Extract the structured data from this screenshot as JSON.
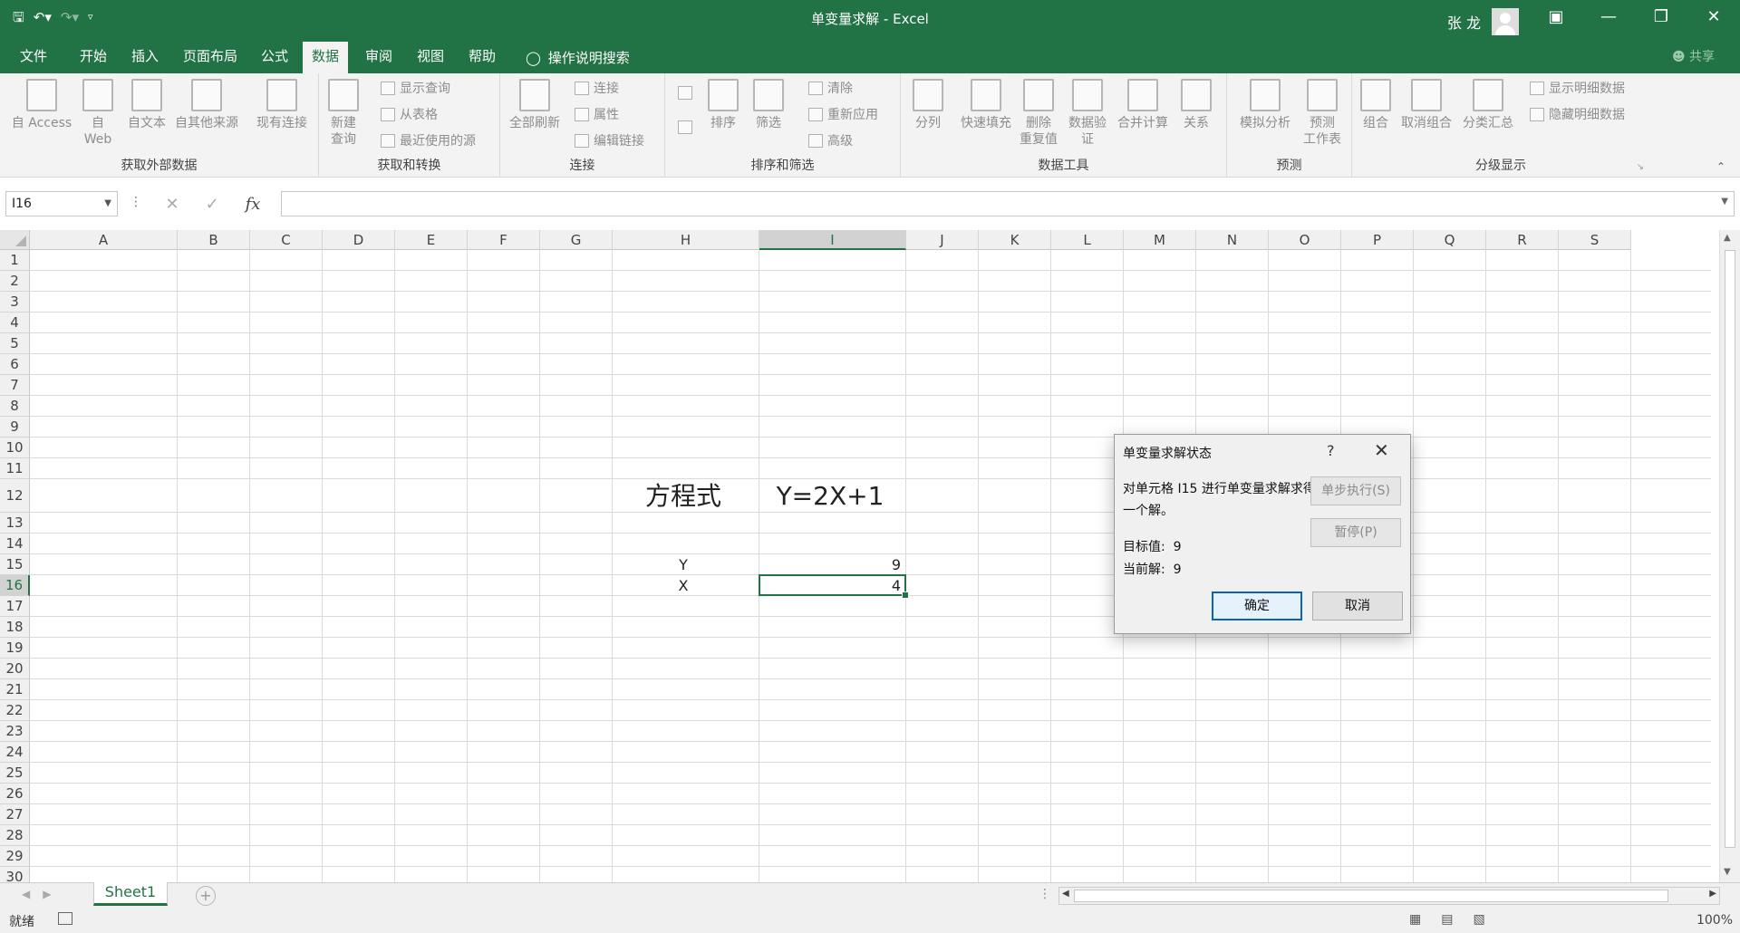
{
  "titlebar": {
    "title": "单变量求解  -  Excel",
    "user_name": "张 龙",
    "save_icon": "save-icon",
    "undo_icon": "undo-icon",
    "redo_icon": "redo-icon"
  },
  "menu": {
    "tabs": [
      "文件",
      "开始",
      "插入",
      "页面布局",
      "公式",
      "数据",
      "审阅",
      "视图",
      "帮助"
    ],
    "active_tab": "数据",
    "search_label": "操作说明搜索",
    "share_label": "共享"
  },
  "ribbon": {
    "groups": {
      "external": "获取外部数据",
      "transform": "获取和转换",
      "connections": "连接",
      "sort_filter": "排序和筛选",
      "data_tools": "数据工具",
      "forecast": "预测",
      "outline": "分级显示"
    },
    "buttons": {
      "from_access": "自 Access",
      "from_web_1": "自",
      "from_web_2": "Web",
      "from_text": "自文本",
      "from_other": "自其他来源",
      "existing_conn": "现有连接",
      "new_query_1": "新建",
      "new_query_2": "查询",
      "show_queries": "显示查询",
      "from_table": "从表格",
      "recent_sources": "最近使用的源",
      "refresh_all": "全部刷新",
      "connections": "连接",
      "properties": "属性",
      "edit_links": "编辑链接",
      "sort": "排序",
      "filter": "筛选",
      "clear": "清除",
      "reapply": "重新应用",
      "advanced": "高级",
      "text_to_columns": "分列",
      "flash_fill": "快速填充",
      "remove_dup_1": "删除",
      "remove_dup_2": "重复值",
      "validation_1": "数据验",
      "validation_2": "证",
      "consolidate": "合并计算",
      "relationships": "关系",
      "whatif": "模拟分析",
      "forecast_1": "预测",
      "forecast_2": "工作表",
      "group": "组合",
      "ungroup": "取消组合",
      "subtotal": "分类汇总",
      "show_detail": "显示明细数据",
      "hide_detail": "隐藏明细数据"
    }
  },
  "formula_bar": {
    "name_box": "I16",
    "fx_label": "fx",
    "formula": ""
  },
  "sheet": {
    "columns": [
      "A",
      "B",
      "C",
      "D",
      "E",
      "F",
      "G",
      "H",
      "I",
      "J",
      "K",
      "L",
      "M",
      "N",
      "O",
      "P",
      "Q",
      "R",
      "S"
    ],
    "selected_column": "I",
    "rows": [
      "1",
      "2",
      "3",
      "4",
      "5",
      "6",
      "7",
      "8",
      "9",
      "10",
      "11",
      "12",
      "13",
      "14",
      "15",
      "16",
      "17",
      "18",
      "19",
      "20",
      "21",
      "22",
      "23",
      "24",
      "25",
      "26",
      "27",
      "28",
      "29",
      "30"
    ],
    "selected_row": "16",
    "cells": {
      "H12": "方程式",
      "I12": "Y=2X+1",
      "H15": "Y",
      "I15": "9",
      "H16": "X",
      "I16": "4"
    }
  },
  "sheet_tabs": {
    "active": "Sheet1",
    "add_label": "+"
  },
  "status": {
    "ready": "就绪",
    "zoom": "100%"
  },
  "dialog": {
    "title": "单变量求解状态",
    "help": "?",
    "message": "对单元格 I15 进行单变量求解求得一个解。",
    "target_label": "目标值:",
    "target_value": "9",
    "current_label": "当前解:",
    "current_value": "9",
    "step_button": "单步执行(S)",
    "pause_button": "暂停(P)",
    "ok_button": "确定",
    "cancel_button": "取消"
  },
  "colors": {
    "accent": "#217346",
    "dialog_default_border": "#0a64b4"
  }
}
